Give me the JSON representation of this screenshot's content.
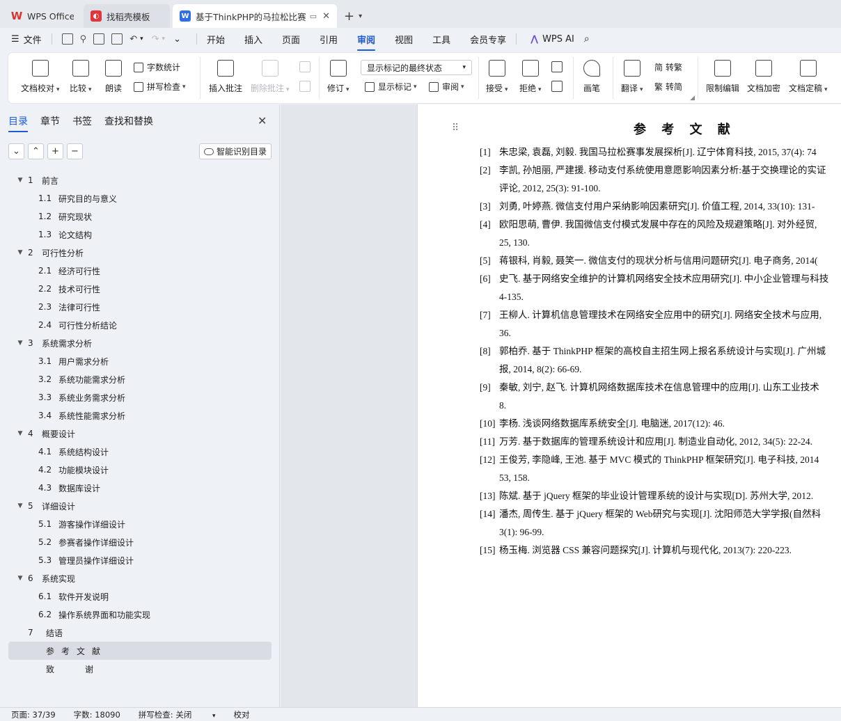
{
  "tabs": [
    {
      "label": "WPS Office",
      "icon": "wps-logo-icon"
    },
    {
      "label": "找稻壳模板",
      "icon": "daoke-logo-icon"
    },
    {
      "label": "基于ThinkPHP的马拉松比赛报",
      "icon": "writer-doc-icon"
    }
  ],
  "menubar": {
    "file": "文件",
    "tabs": [
      "开始",
      "插入",
      "页面",
      "引用",
      "审阅",
      "视图",
      "工具",
      "会员专享"
    ],
    "active_tab": "审阅",
    "ai": "WPS AI"
  },
  "ribbon": {
    "doc_check": "文档校对",
    "compare": "比较",
    "read_aloud": "朗读",
    "word_count": "字数统计",
    "spell_check": "拼写检查",
    "insert_comment": "插入批注",
    "delete_comment": "删除批注",
    "track_changes": "修订",
    "markup_state": "显示标记的最终状态",
    "show_markup": "显示标记",
    "review": "审阅",
    "accept": "接受",
    "reject": "拒绝",
    "ink": "画笔",
    "translate": "翻译",
    "to_traditional": "转繁",
    "to_simplified": "转简",
    "restrict_edit": "限制编辑",
    "encrypt": "文档加密",
    "finalize": "文档定稿",
    "accent_color": "#1e5bd6"
  },
  "nav": {
    "tabs": [
      "目录",
      "章节",
      "书签",
      "查找和替换"
    ],
    "active_tab": "目录",
    "smart_toc": "智能识别目录",
    "toc": [
      {
        "num": "1",
        "text": "前言",
        "level": 1
      },
      {
        "num": "1.1",
        "text": "研究目的与意义",
        "level": 2
      },
      {
        "num": "1.2",
        "text": "研究现状",
        "level": 2
      },
      {
        "num": "1.3",
        "text": "论文结构",
        "level": 2
      },
      {
        "num": "2",
        "text": "可行性分析",
        "level": 1
      },
      {
        "num": "2.1",
        "text": "经济可行性",
        "level": 2
      },
      {
        "num": "2.2",
        "text": "技术可行性",
        "level": 2
      },
      {
        "num": "2.3",
        "text": "法律可行性",
        "level": 2
      },
      {
        "num": "2.4",
        "text": "可行性分析结论",
        "level": 2
      },
      {
        "num": "3",
        "text": "系统需求分析",
        "level": 1
      },
      {
        "num": "3.1",
        "text": "用户需求分析",
        "level": 2
      },
      {
        "num": "3.2",
        "text": "系统功能需求分析",
        "level": 2
      },
      {
        "num": "3.3",
        "text": "系统业务需求分析",
        "level": 2
      },
      {
        "num": "3.4",
        "text": "系统性能需求分析",
        "level": 2
      },
      {
        "num": "4",
        "text": "概要设计",
        "level": 1
      },
      {
        "num": "4.1",
        "text": "系统结构设计",
        "level": 2
      },
      {
        "num": "4.2",
        "text": "功能模块设计",
        "level": 2
      },
      {
        "num": "4.3",
        "text": "数据库设计",
        "level": 2
      },
      {
        "num": "5",
        "text": "详细设计",
        "level": 1
      },
      {
        "num": "5.1",
        "text": "游客操作详细设计",
        "level": 2
      },
      {
        "num": "5.2",
        "text": "参赛者操作详细设计",
        "level": 2
      },
      {
        "num": "5.3",
        "text": "管理员操作详细设计",
        "level": 2
      },
      {
        "num": "6",
        "text": "系统实现",
        "level": 1
      },
      {
        "num": "6.1",
        "text": "软件开发说明",
        "level": 2
      },
      {
        "num": "6.2",
        "text": "操作系统界面和功能实现",
        "level": 2
      },
      {
        "num": "7",
        "text": "结语",
        "level": 0
      },
      {
        "num": "",
        "text": "参考文献",
        "level": 0,
        "selected": true
      },
      {
        "num": "",
        "text": "致谢",
        "level": 0
      }
    ]
  },
  "document": {
    "title": "参 考 文 献",
    "references": [
      {
        "num": "[1]",
        "lines": [
          "朱忠梁, 袁磊, 刘毅. 我国马拉松赛事发展探析[J]. 辽宁体育科技, 2015, 37(4): 74"
        ]
      },
      {
        "num": "[2]",
        "lines": [
          "李凯, 孙旭丽, 严建援. 移动支付系统使用意愿影响因素分析:基于交换理论的实证",
          "评论, 2012, 25(3): 91-100."
        ]
      },
      {
        "num": "[3]",
        "lines": [
          "刘勇, 叶婷燕. 微信支付用户采纳影响因素研究[J]. 价值工程, 2014, 33(10): 131-"
        ]
      },
      {
        "num": "[4]",
        "lines": [
          "欧阳思萌, 曹伊. 我国微信支付模式发展中存在的风险及规避策略[J]. 对外经贸,",
          "25, 130."
        ]
      },
      {
        "num": "[5]",
        "lines": [
          "蒋银科, 肖毅, 聂笑一. 微信支付的现状分析与信用问题研究[J]. 电子商务, 2014("
        ]
      },
      {
        "num": "[6]",
        "lines": [
          "史飞. 基于网络安全维护的计算机网络安全技术应用研究[J]. 中小企业管理与科技",
          "4-135."
        ]
      },
      {
        "num": "[7]",
        "lines": [
          "王柳人. 计算机信息管理技术在网络安全应用中的研究[J]. 网络安全技术与应用,",
          "36."
        ]
      },
      {
        "num": "[8]",
        "lines": [
          "郭柏乔. 基于 ThinkPHP 框架的高校自主招生网上报名系统设计与实现[J]. 广州城",
          "报, 2014, 8(2): 66-69."
        ]
      },
      {
        "num": "[9]",
        "lines": [
          "秦敏, 刘宁, 赵飞. 计算机网络数据库技术在信息管理中的应用[J]. 山东工业技术",
          "8."
        ]
      },
      {
        "num": "[10]",
        "lines": [
          "李杨. 浅谈网络数据库系统安全[J]. 电脑迷, 2017(12): 46."
        ]
      },
      {
        "num": "[11]",
        "lines": [
          "万芳. 基于数据库的管理系统设计和应用[J]. 制造业自动化, 2012, 34(5): 22-24."
        ]
      },
      {
        "num": "[12]",
        "lines": [
          "王俊芳, 李隐峰, 王池. 基于 MVC 模式的 ThinkPHP 框架研究[J]. 电子科技, 2014",
          "53, 158."
        ]
      },
      {
        "num": "[13]",
        "lines": [
          "陈斌. 基于 jQuery 框架的毕业设计管理系统的设计与实现[D]. 苏州大学, 2012."
        ]
      },
      {
        "num": "[14]",
        "lines": [
          "潘杰, 周传生. 基于 jQuery 框架的 Web研究与实现[J]. 沈阳师范大学学报(自然科",
          "3(1): 96-99."
        ]
      },
      {
        "num": "[15]",
        "lines": [
          "杨玉梅. 浏览器 CSS 兼容问题探究[J]. 计算机与现代化, 2013(7): 220-223."
        ]
      }
    ]
  },
  "status": {
    "page": "页面: 37/39",
    "words": "字数: 18090",
    "spell": "拼写检查: 关闭",
    "proof": "校对"
  }
}
